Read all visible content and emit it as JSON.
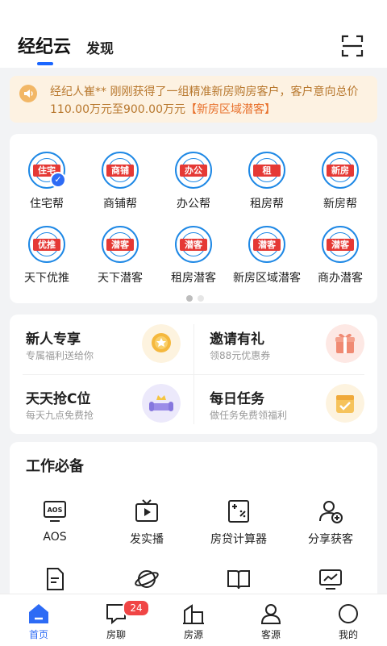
{
  "header": {
    "tabs": [
      {
        "label": "经纪云",
        "active": true
      },
      {
        "label": "发现",
        "active": false
      }
    ],
    "scan_icon": "scan-icon"
  },
  "notice": {
    "icon": "speaker-icon",
    "text": "经纪人崔** 刚刚获得了一组精准新房购房客户，客户意向总价110.00万元至900.00万元",
    "highlight": "【新房区域潜客】"
  },
  "services": {
    "items": [
      {
        "label": "住宅帮",
        "badge": "住宅"
      },
      {
        "label": "商铺帮",
        "badge": "商铺"
      },
      {
        "label": "办公帮",
        "badge": "办公"
      },
      {
        "label": "租房帮",
        "badge": "租"
      },
      {
        "label": "新房帮",
        "badge": "新房"
      },
      {
        "label": "天下优推",
        "badge": "优推"
      },
      {
        "label": "天下潜客",
        "badge": "潜客"
      },
      {
        "label": "租房潜客",
        "badge": "潜客"
      },
      {
        "label": "新房区域潜客",
        "badge": "潜客"
      },
      {
        "label": "商办潜客",
        "badge": "潜客"
      }
    ],
    "pager": {
      "pages": 2,
      "current": 1
    }
  },
  "promos": [
    {
      "title": "新人专享",
      "subtitle": "专属福利送给你",
      "icon": "coin-icon"
    },
    {
      "title": "邀请有礼",
      "subtitle": "领88元优惠券",
      "icon": "gift-icon"
    },
    {
      "title": "天天抢C位",
      "subtitle": "每天九点免费抢",
      "icon": "crown-sofa-icon"
    },
    {
      "title": "每日任务",
      "subtitle": "做任务免费领福利",
      "icon": "calendar-check-icon"
    }
  ],
  "tools": {
    "title": "工作必备",
    "items": [
      {
        "label": "AOS",
        "icon": "aos-monitor-icon"
      },
      {
        "label": "发实播",
        "icon": "live-play-icon"
      },
      {
        "label": "房贷计算器",
        "icon": "calculator-icon"
      },
      {
        "label": "分享获客",
        "icon": "user-add-icon"
      }
    ],
    "partial_icons": [
      "document-icon",
      "planet-icon",
      "book-icon",
      "chart-monitor-icon"
    ]
  },
  "bottom_nav": {
    "items": [
      {
        "label": "首页",
        "icon": "home-icon",
        "active": true
      },
      {
        "label": "房聊",
        "icon": "chat-icon",
        "badge": "24"
      },
      {
        "label": "房源",
        "icon": "building-icon"
      },
      {
        "label": "客源",
        "icon": "person-icon"
      },
      {
        "label": "我的",
        "icon": "profile-circle-icon"
      }
    ]
  },
  "colors": {
    "accent": "#2d6bf5",
    "notice_bg": "#fdf2e2",
    "notice_text": "#b8782e",
    "notice_highlight": "#e8702b",
    "badge_red": "#f04545",
    "logo_blue": "#1e88e5",
    "logo_red": "#e53935"
  }
}
